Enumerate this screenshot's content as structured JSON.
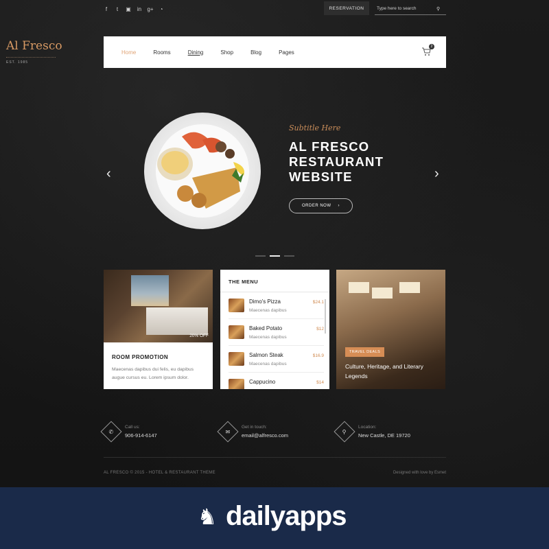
{
  "topbar": {
    "social": [
      {
        "icon": "facebook-icon",
        "glyph": "f"
      },
      {
        "icon": "twitter-icon",
        "glyph": "t"
      },
      {
        "icon": "instagram-icon",
        "glyph": "▣"
      },
      {
        "icon": "linkedin-icon",
        "glyph": "in"
      },
      {
        "icon": "google-plus-icon",
        "glyph": "g+"
      },
      {
        "icon": "rss-icon",
        "glyph": "◔"
      }
    ],
    "reservation_label": "RESERVATION",
    "search_placeholder": "Type here to search"
  },
  "logo": {
    "name": "Al Fresco",
    "est": "EST. 1985"
  },
  "nav": {
    "items": [
      {
        "label": "Home",
        "active": true
      },
      {
        "label": "Rooms"
      },
      {
        "label": "Dining"
      },
      {
        "label": "Shop"
      },
      {
        "label": "Blog"
      },
      {
        "label": "Pages"
      }
    ],
    "cart_count": "2"
  },
  "hero": {
    "subtitle": "Subtitle Here",
    "title": "AL FRESCO RESTAURANT WEBSITE",
    "button": "ORDER NOW"
  },
  "cards": {
    "room": {
      "discount": "20% OFF",
      "heading": "ROOM PROMOTION",
      "text": "Maecenas dapibus dui felis, eu dapibus augue cursus eu. Lorem ipsum dolor."
    },
    "menu": {
      "heading": "THE MENU",
      "items": [
        {
          "name": "Dimo's Pizza",
          "desc": "Maecenas dapibus",
          "price": "$24.1"
        },
        {
          "name": "Baked Potato",
          "desc": "Maecenas dapibus",
          "price": "$12"
        },
        {
          "name": "Salmon Steak",
          "desc": "Maecenas dapibus",
          "price": "$16.9"
        },
        {
          "name": "Cappucino",
          "desc": "",
          "price": "$14"
        }
      ]
    },
    "travel": {
      "tag": "TRAVEL DEALS",
      "caption": "Culture, Heritage, and Literary Legends"
    }
  },
  "contact": {
    "call": {
      "label": "Call us:",
      "value": "906-914-6147"
    },
    "email": {
      "label": "Get in touch:",
      "value": "email@alfresco.com"
    },
    "location": {
      "label": "Location:",
      "value": "New Castle, DE 19720"
    }
  },
  "footer": {
    "copyright": "AL FRESCO © 2015 - HOTEL & RESTAURANT THEME",
    "design": "Designed with love by Esmet"
  },
  "watermark": "dailyapps",
  "colors": {
    "accent": "#d89a64",
    "background": "#161616",
    "brandbar": "#1a2a49"
  }
}
